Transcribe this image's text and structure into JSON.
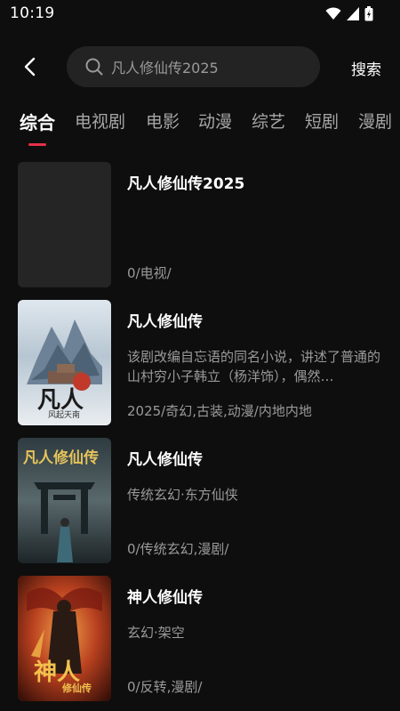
{
  "status_bar": {
    "time": "10:19"
  },
  "header": {
    "search_value": "凡人修仙传2025",
    "search_button": "搜索"
  },
  "tabs": [
    {
      "label": "综合",
      "active": true
    },
    {
      "label": "电视剧"
    },
    {
      "label": "电影"
    },
    {
      "label": "动漫"
    },
    {
      "label": "综艺"
    },
    {
      "label": "短剧"
    },
    {
      "label": "漫剧"
    }
  ],
  "results": [
    {
      "title": "凡人修仙传2025",
      "desc": "",
      "meta": "0/电视/"
    },
    {
      "title": "凡人修仙传",
      "desc": "该剧改编自忘语的同名小说，讲述了普通的山村穷小子韩立（杨洋饰），偶然…",
      "meta": "2025/奇幻,古装,动漫/内地内地"
    },
    {
      "title": "凡人修仙传",
      "desc": "传统玄幻·东方仙侠",
      "meta": "0/传统玄幻,漫剧/"
    },
    {
      "title": "神人修仙传",
      "desc": "玄幻·架空",
      "meta": "0/反转,漫剧/"
    }
  ],
  "posters": {
    "poster2_title": "凡人",
    "poster2_sub": "风起天南",
    "poster3_title": "凡人修仙传",
    "poster4_title": "神人",
    "poster4_sub": "修仙传"
  },
  "colors": {
    "accent": "#e8304a",
    "background": "#0e0e0e",
    "search_bg": "#232323"
  }
}
